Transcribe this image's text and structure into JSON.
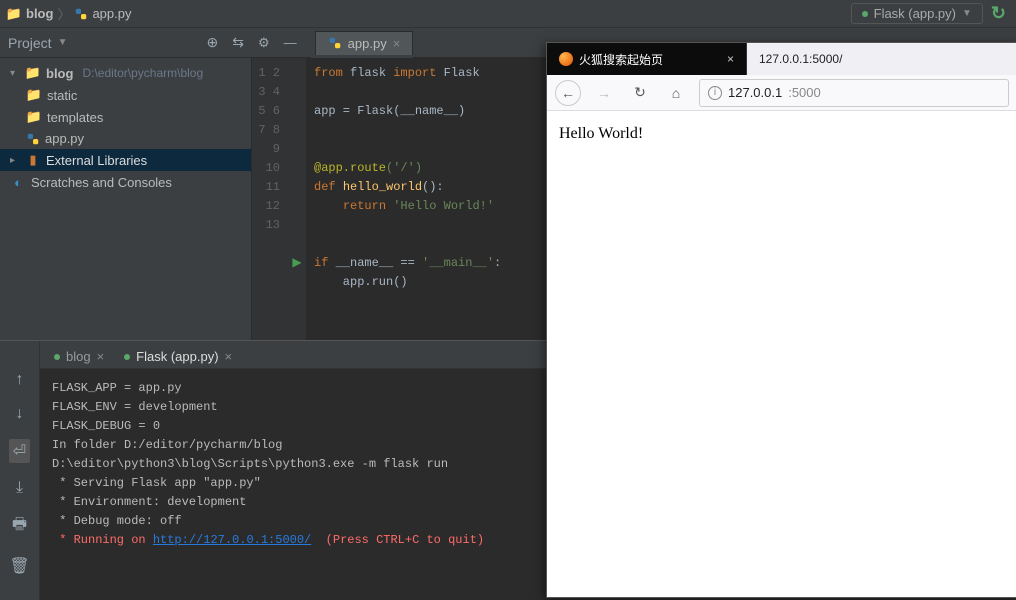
{
  "breadcrumb": {
    "folder": "blog",
    "file": "app.py"
  },
  "run_config": {
    "label": "Flask (app.py)"
  },
  "project_panel": {
    "title": "Project"
  },
  "tree": {
    "root_name": "blog",
    "root_path": "D:\\editor\\pycharm\\blog",
    "items": [
      {
        "label": "static"
      },
      {
        "label": "templates"
      },
      {
        "label": "app.py"
      }
    ],
    "external_libraries": "External Libraries",
    "scratches": "Scratches and Consoles"
  },
  "editor_tab": {
    "label": "app.py"
  },
  "code_lines": {
    "l1_from": "from",
    "l1_mod": " flask ",
    "l1_import": "import",
    "l1_name": " Flask",
    "l3_a": "app = Flask(",
    "l3_b": "__name__",
    "l3_c": ")",
    "l6_dec": "@app.route",
    "l6_arg": "('/')",
    "l7_def": "def ",
    "l7_fn": "hello_world",
    "l7_end": "():",
    "l8_ret": "return ",
    "l8_str": "'Hello World!'",
    "l11_if": "if ",
    "l11_name": "__name__",
    "l11_eq": " == ",
    "l11_main": "'__main__'",
    "l11_colon": ":",
    "l12": "    app.run()"
  },
  "line_numbers": [
    "1",
    "2",
    "3",
    "4",
    "5",
    "6",
    "7",
    "8",
    "9",
    "10",
    "11",
    "12",
    "13"
  ],
  "console_tabs": {
    "left": "blog",
    "right": "Flask (app.py)"
  },
  "console": {
    "l1": "FLASK_APP = app.py",
    "l2": "FLASK_ENV = development",
    "l3": "FLASK_DEBUG = 0",
    "l4": "In folder D:/editor/pycharm/blog",
    "l5": "D:\\editor\\python3\\blog\\Scripts\\python3.exe -m flask run",
    "l6": " * Serving Flask app \"app.py\"",
    "l7": " * Environment: development",
    "l8": " * Debug mode: off",
    "l9_a": " * Running on ",
    "l9_url": "http://127.0.0.1:5000/",
    "l9_b": "  (Press CTRL+C to quit)"
  },
  "browser": {
    "tab_active": "火狐搜索起始页",
    "tab_inactive": "127.0.0.1:5000/",
    "url_host": "127.0.0.1",
    "url_port": ":5000",
    "content": "Hello World!"
  }
}
